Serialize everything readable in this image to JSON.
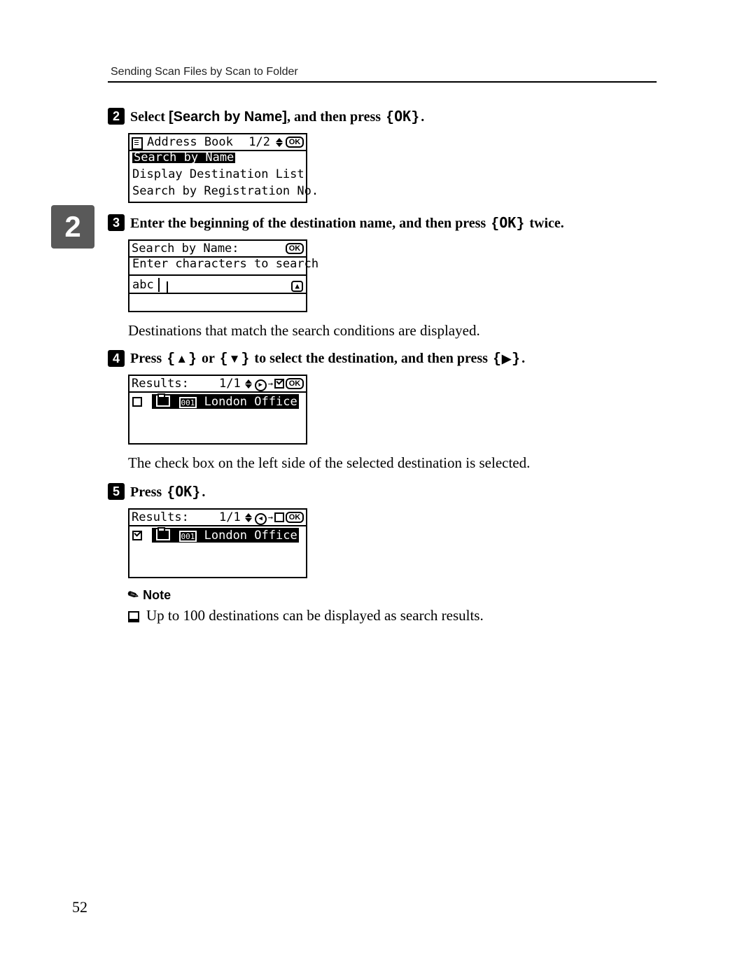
{
  "header": {
    "running_head": "Sending Scan Files by Scan to Folder"
  },
  "chapter_badge": "2",
  "steps": {
    "s2": {
      "num": "2",
      "segments": [
        "Select ",
        "[Search by Name]",
        ", and then press ",
        "{OK}",
        "."
      ]
    },
    "s3": {
      "num": "3",
      "segments": [
        "Enter the beginning of the destination name, and then press ",
        "{OK}",
        " twice."
      ]
    },
    "s3_after": "Destinations that match the search conditions are displayed.",
    "s4": {
      "num": "4",
      "segments": [
        "Press ",
        "{▲}",
        " or ",
        "{▼}",
        " to select the destination, and then press ",
        "{▶}",
        "."
      ]
    },
    "s4_after": "The check box on the left side of the selected destination is selected.",
    "s5": {
      "num": "5",
      "segments": [
        "Press ",
        "{OK}",
        "."
      ]
    }
  },
  "lcd1": {
    "title": "Address Book",
    "counter": "1/2",
    "ok": "OK",
    "rows": [
      "Search by Name",
      "Display Destination List",
      "Search by Registration No."
    ]
  },
  "lcd2": {
    "title": "Search by Name:",
    "ok": "OK",
    "hint": "Enter characters to search",
    "input_mode": "abc",
    "input_value": ""
  },
  "lcd3": {
    "title": "Results:",
    "counter": "1/1",
    "ok": "OK",
    "item": {
      "checked": false,
      "num": "001",
      "name": "London Office"
    }
  },
  "lcd4": {
    "title": "Results:",
    "counter": "1/1",
    "ok": "OK",
    "item": {
      "checked": true,
      "num": "001",
      "name": "London Office"
    }
  },
  "note": {
    "label": "Note",
    "items": [
      "Up to 100 destinations can be displayed as search results."
    ]
  },
  "page_number": "52"
}
